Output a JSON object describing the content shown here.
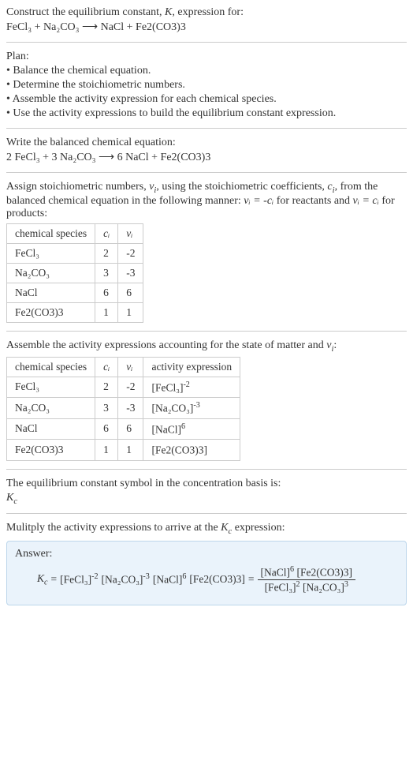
{
  "header": {
    "line1_a": "Construct the equilibrium constant, ",
    "line1_k": "K",
    "line1_b": ", expression for:",
    "unbalanced": "FeCl₃ + Na₂CO₃  ⟶  NaCl + Fe2(CO3)3"
  },
  "plan": {
    "title": "Plan:",
    "b1": "• Balance the chemical equation.",
    "b2": "• Determine the stoichiometric numbers.",
    "b3": "• Assemble the activity expression for each chemical species.",
    "b4": "• Use the activity expressions to build the equilibrium constant expression."
  },
  "balanced": {
    "title": "Write the balanced chemical equation:",
    "eq": "2 FeCl₃ + 3 Na₂CO₃  ⟶  6 NaCl + Fe2(CO3)3"
  },
  "stoich": {
    "intro_a": "Assign stoichiometric numbers, ",
    "nu": "ν",
    "sub_i": "i",
    "intro_b": ", using the stoichiometric coefficients, ",
    "c": "c",
    "intro_c": ", from the balanced chemical equation in the following manner: ",
    "rel1": "νᵢ = -cᵢ",
    "intro_d": " for reactants and ",
    "rel2": "νᵢ = cᵢ",
    "intro_e": " for products:",
    "hdr1": "chemical species",
    "hdr2": "cᵢ",
    "hdr3": "νᵢ",
    "rows": [
      {
        "sp": "FeCl₃",
        "c": "2",
        "v": "-2"
      },
      {
        "sp": "Na₂CO₃",
        "c": "3",
        "v": "-3"
      },
      {
        "sp": "NaCl",
        "c": "6",
        "v": "6"
      },
      {
        "sp": "Fe2(CO3)3",
        "c": "1",
        "v": "1"
      }
    ]
  },
  "activity": {
    "intro_a": "Assemble the activity expressions accounting for the state of matter and ",
    "intro_b": ":",
    "hdr1": "chemical species",
    "hdr2": "cᵢ",
    "hdr3": "νᵢ",
    "hdr4": "activity expression",
    "rows": [
      {
        "sp": "FeCl₃",
        "c": "2",
        "v": "-2",
        "a_base": "[FeCl₃]",
        "a_exp": "-2"
      },
      {
        "sp": "Na₂CO₃",
        "c": "3",
        "v": "-3",
        "a_base": "[Na₂CO₃]",
        "a_exp": "-3"
      },
      {
        "sp": "NaCl",
        "c": "6",
        "v": "6",
        "a_base": "[NaCl]",
        "a_exp": "6"
      },
      {
        "sp": "Fe2(CO3)3",
        "c": "1",
        "v": "1",
        "a_base": "[Fe2(CO3)3]",
        "a_exp": ""
      }
    ]
  },
  "basis": {
    "line1": "The equilibrium constant symbol in the concentration basis is:",
    "kc_k": "K",
    "kc_c": "c"
  },
  "mult": {
    "line_a": "Mulitply the activity expressions to arrive at the ",
    "kc_k": "K",
    "kc_c": "c",
    "line_b": " expression:"
  },
  "answer": {
    "label": "Answer:",
    "kc_k": "K",
    "kc_c": "c",
    "eq_sign": " = ",
    "t1b": "[FeCl₃]",
    "t1e": "-2",
    "t2b": "[Na₂CO₃]",
    "t2e": "-3",
    "t3b": "[NaCl]",
    "t3e": "6",
    "t4b": "[Fe2(CO3)3]",
    "eq2": " = ",
    "num1b": "[NaCl]",
    "num1e": "6",
    "num2b": "[Fe2(CO3)3]",
    "den1b": "[FeCl₃]",
    "den1e": "2",
    "den2b": "[Na₂CO₃]",
    "den2e": "3"
  }
}
